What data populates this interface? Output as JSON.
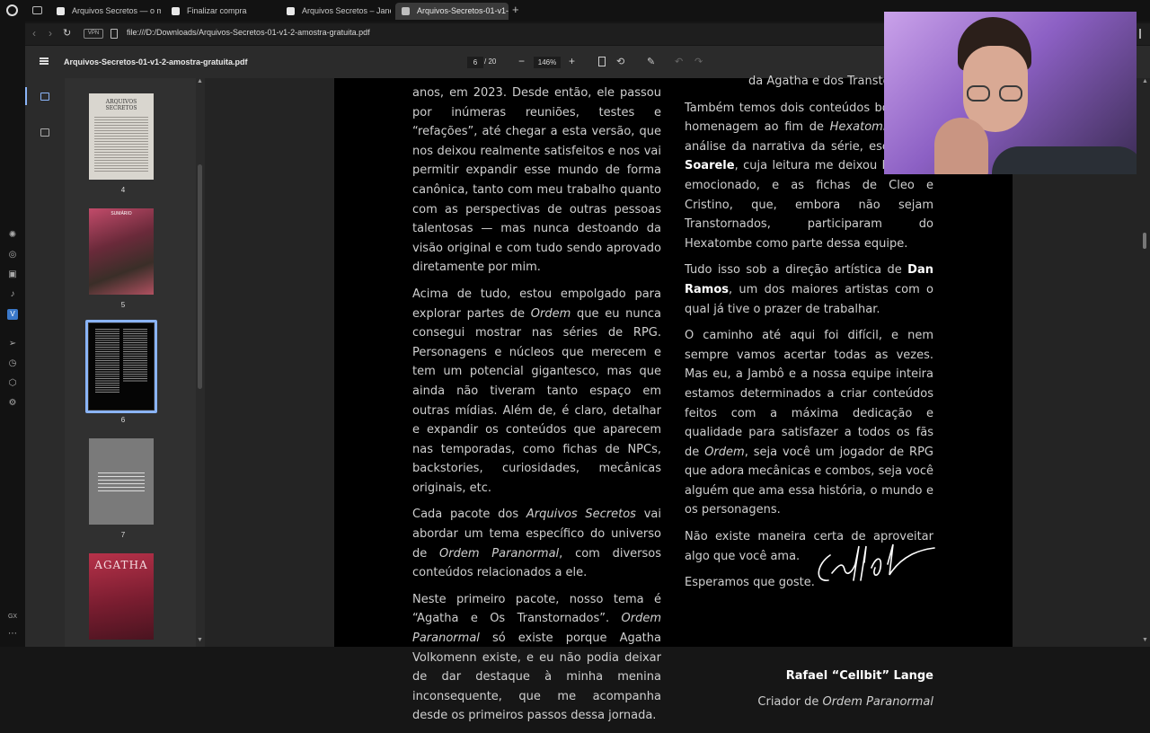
{
  "tabs": [
    {
      "label": "Arquivos Secretos — o ma",
      "active": false,
      "color": "#e8e8e8"
    },
    {
      "label": "Finalizar compra",
      "active": false,
      "color": "#e8e8e8"
    },
    {
      "label": "Arquivos Secretos – Jane",
      "active": false,
      "color": "#e8e8e8"
    },
    {
      "label": "Arquivos-Secretos-01-v1-",
      "active": true,
      "color": "#bdbdbd"
    }
  ],
  "address": {
    "vpn": "VPN",
    "url": "file:///D:/Downloads/Arquivos-Secretos-01-v1-2-amostra-gratuita.pdf"
  },
  "pdf_toolbar": {
    "filename": "Arquivos-Secretos-01-v1-2-amostra-gratuita.pdf",
    "current_page": "6",
    "total_pages": "/ 20",
    "zoom": "146%"
  },
  "thumbnails": [
    {
      "number": "4",
      "caption": "ARQUIVOS SECRETOS",
      "style": "light"
    },
    {
      "number": "5",
      "caption": "SUMÁRIO",
      "style": "red"
    },
    {
      "number": "6",
      "caption": "",
      "style": "dark",
      "selected": true
    },
    {
      "number": "7",
      "caption": "",
      "style": "gray"
    },
    {
      "number": "",
      "caption": "AGATHA",
      "style": "agatha"
    }
  ],
  "left_column": {
    "paragraphs": [
      [
        "anos, em 2023. Desde então, ele passou por inúmeras reuniões, testes e “refações”, até chegar a esta versão, que nos deixou realmente satisfeitos e nos vai permitir expandir esse mundo de forma canônica, tanto com meu trabalho quanto com as perspectivas de outras pessoas talentosas — mas nunca destoando da visão original e com tudo sendo aprovado diretamente por mim."
      ],
      [
        "Acima de tudo, estou empolgado para explorar partes de ",
        "Ordem",
        " que eu nunca consegui mostrar nas séries de RPG. Personagens e núcleos que merecem e tem um potencial gigantesco, mas que ainda não tiveram tanto espaço em outras mídias. Além de, é claro, detalhar e expandir os conteúdos que aparecem nas temporadas, como fichas de NPCs, backstories, curiosidades, mecânicas originais, etc."
      ],
      [
        "Cada pacote dos ",
        "Arquivos Secretos",
        " vai abordar um tema específico do universo de ",
        "Ordem Paranormal",
        ", com diversos conteúdos relacionados a ele."
      ],
      [
        "Neste primeiro pacote, nosso tema é “Agatha e Os Transtornados”. ",
        "Ordem Paranormal",
        " só existe porque Agatha Volkomenn existe, e eu não podia deixar de dar destaque à minha menina inconsequente, que me acompanha desde os primeiros passos dessa jornada."
      ]
    ]
  },
  "right_column": {
    "top_line": "da Agatha e dos Transtornados.",
    "paragraphs": [
      [
        "Também temos dois conteúdos bônus em homenagem ao fim de ",
        "Hexatombe",
        ": uma análise da narrativa da série, escrita por ",
        "Soarele",
        ", cuja leitura me deixou bastante emocionado, e as fichas de Cleo e Cristino, que, embora não sejam Transtornados, participaram do Hexatombe como parte dessa equipe."
      ],
      [
        "Tudo isso sob a direção artística de ",
        "Dan Ramos",
        ", um dos maiores artistas com o qual já tive o prazer de trabalhar."
      ],
      [
        "O caminho até aqui foi difícil, e nem sempre vamos acertar todas as vezes. Mas eu, a Jambô e a nossa equipe inteira estamos determinados a criar conteúdos feitos com a máxima dedicação e qualidade para satisfazer a todos os fãs de ",
        "Ordem",
        ", seja você um jogador de RPG que adora mecânicas e combos, seja você alguém que ama essa história, o mundo e os personagens."
      ],
      [
        "Não existe maneira certa de aproveitar algo que você ama."
      ]
    ],
    "closing": "Esperamos que goste.",
    "signature": "Cellbit",
    "author": "Rafael “Cellbit” Lange",
    "role_prefix": "Criador de ",
    "role_work": "Ordem Paranormal"
  },
  "sidebar_icons": [
    "opera-logo-icon",
    "workspaces-icon",
    "chatgpt-icon",
    "whatsapp-icon",
    "instagram-icon",
    "tiktok-icon",
    "vk-icon",
    "send-icon",
    "history-icon",
    "extensions-icon",
    "settings-icon",
    "gx-icon",
    "more-icon"
  ],
  "accent_color": "#8ab4f8"
}
